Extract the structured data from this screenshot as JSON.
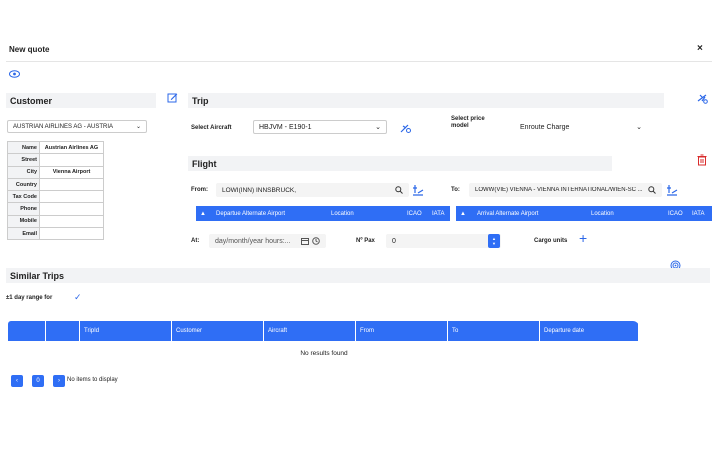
{
  "dialog": {
    "title": "New quote",
    "close": "×"
  },
  "customer": {
    "heading": "Customer",
    "selected": "AUSTRIAN AIRLINES AG - AUSTRIA",
    "rows": [
      {
        "k": "Name",
        "v": "Austrian Airlines AG"
      },
      {
        "k": "Street",
        "v": ""
      },
      {
        "k": "City",
        "v": "Vienna Airport"
      },
      {
        "k": "Country",
        "v": ""
      },
      {
        "k": "Tax Code",
        "v": ""
      },
      {
        "k": "Phone",
        "v": ""
      },
      {
        "k": "Mobile",
        "v": ""
      },
      {
        "k": "Email",
        "v": ""
      }
    ]
  },
  "trip": {
    "heading": "Trip",
    "aircraft_label": "Select Aircraft",
    "aircraft_value": "HBJVM - E190-1",
    "price_label": "Select price model",
    "price_value": "Enroute Charge"
  },
  "flight": {
    "heading": "Flight",
    "from_label": "From:",
    "from_value": "LOWI(INN) INNSBRUCK,",
    "to_label": "To:",
    "to_value": "LOWW(VIE) VIENNA - VIENNA INTERNATIONAL/WIEN-SC ...",
    "dep_alt": {
      "title": "Departue Alternate Airport",
      "location": "Location",
      "icao": "ICAO",
      "iata": "IATA"
    },
    "arr_alt": {
      "title": "Arrival Alternate Airport",
      "location": "Location",
      "icao": "ICAO",
      "iata": "IATA"
    },
    "at_label": "At:",
    "at_placeholder": "day/month/year hours:...",
    "pax_label": "Nº Pax",
    "pax_value": "0",
    "cargo_label": "Cargo units"
  },
  "similar": {
    "heading": "Similar Trips",
    "range_label": "±1 day range for",
    "columns": [
      "",
      "",
      "TripId",
      "Customer",
      "Aircraft",
      "From",
      "To",
      "Departure date"
    ],
    "empty": "No results found",
    "page": "0",
    "no_items": "No items to display"
  }
}
